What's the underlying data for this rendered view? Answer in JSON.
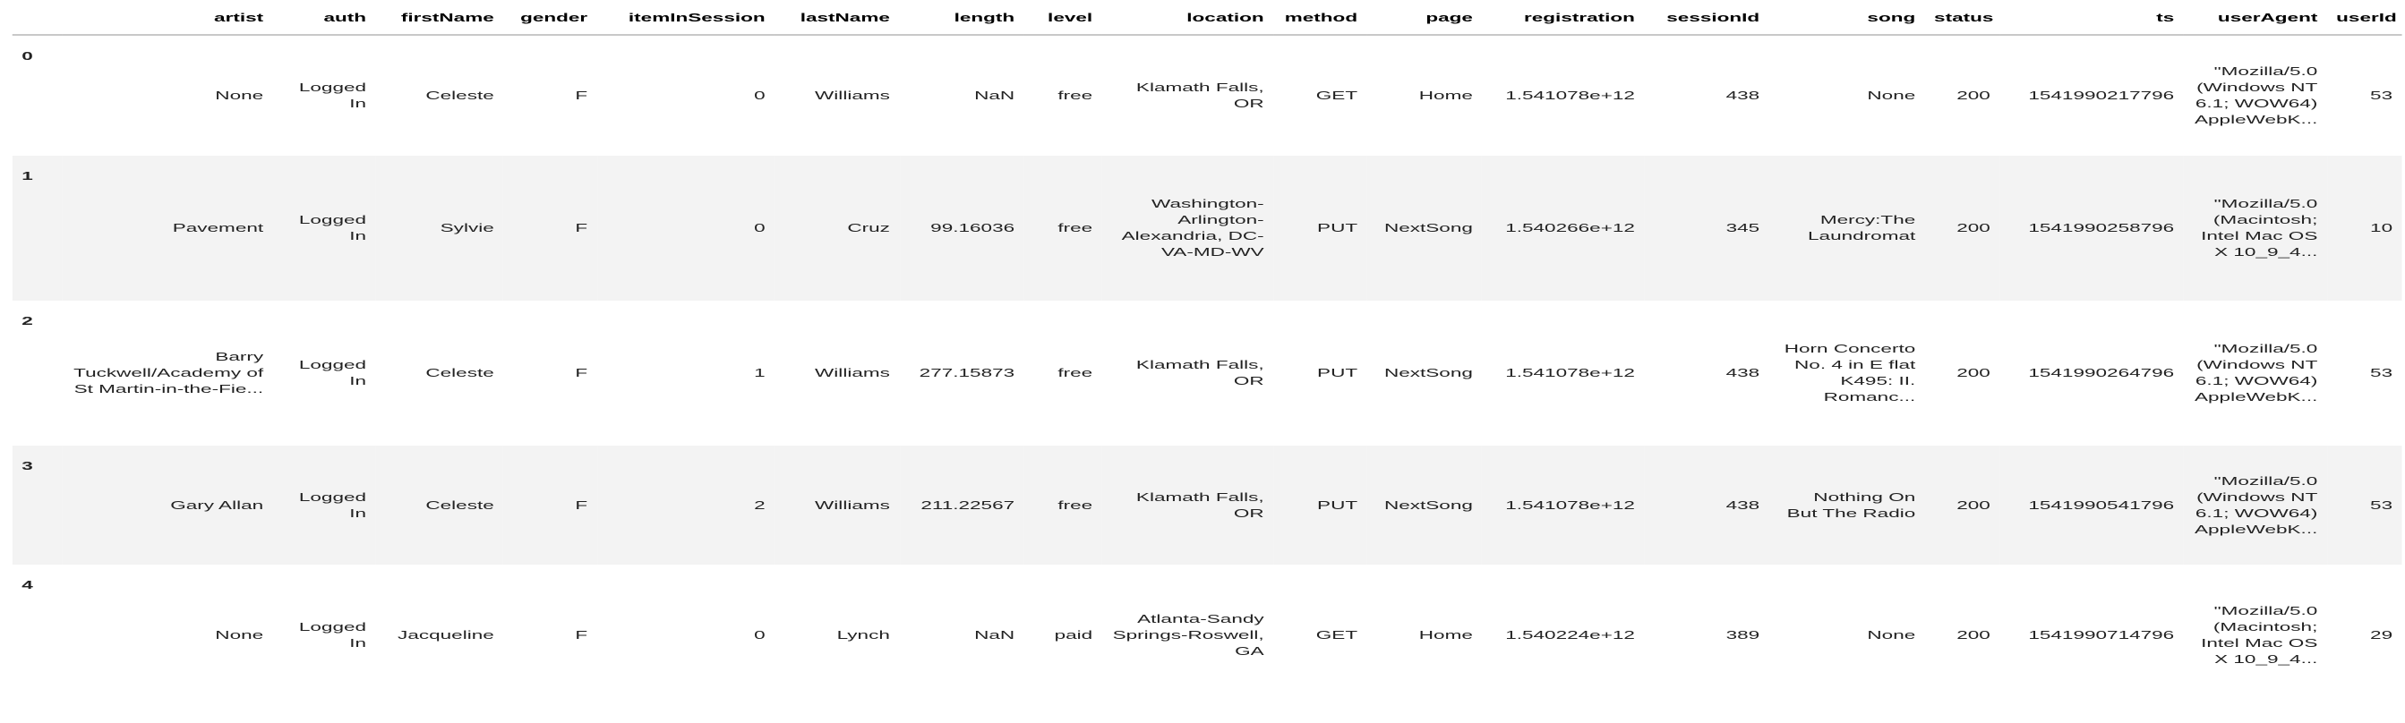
{
  "table": {
    "columns": [
      "",
      "artist",
      "auth",
      "firstName",
      "gender",
      "itemInSession",
      "lastName",
      "length",
      "level",
      "location",
      "method",
      "page",
      "registration",
      "sessionId",
      "song",
      "status",
      "ts",
      "userAgent",
      "userId"
    ],
    "rows": [
      {
        "index": "0",
        "artist": "None",
        "auth": "Logged In",
        "firstName": "Celeste",
        "gender": "F",
        "itemInSession": "0",
        "lastName": "Williams",
        "length": "NaN",
        "level": "free",
        "location": "Klamath Falls, OR",
        "method": "GET",
        "page": "Home",
        "registration": "1.541078e+12",
        "sessionId": "438",
        "song": "None",
        "status": "200",
        "ts": "1541990217796",
        "userAgent": "\"Mozilla/5.0 (Windows NT 6.1; WOW64) AppleWebK...",
        "userId": "53"
      },
      {
        "index": "1",
        "artist": "Pavement",
        "auth": "Logged In",
        "firstName": "Sylvie",
        "gender": "F",
        "itemInSession": "0",
        "lastName": "Cruz",
        "length": "99.16036",
        "level": "free",
        "location": "Washington-Arlington-Alexandria, DC-VA-MD-WV",
        "method": "PUT",
        "page": "NextSong",
        "registration": "1.540266e+12",
        "sessionId": "345",
        "song": "Mercy:The Laundromat",
        "status": "200",
        "ts": "1541990258796",
        "userAgent": "\"Mozilla/5.0 (Macintosh; Intel Mac OS X 10_9_4...",
        "userId": "10"
      },
      {
        "index": "2",
        "artist": "Barry Tuckwell/Academy of St Martin-in-the-Fie...",
        "auth": "Logged In",
        "firstName": "Celeste",
        "gender": "F",
        "itemInSession": "1",
        "lastName": "Williams",
        "length": "277.15873",
        "level": "free",
        "location": "Klamath Falls, OR",
        "method": "PUT",
        "page": "NextSong",
        "registration": "1.541078e+12",
        "sessionId": "438",
        "song": "Horn Concerto No. 4 in E flat K495: II. Romanc...",
        "status": "200",
        "ts": "1541990264796",
        "userAgent": "\"Mozilla/5.0 (Windows NT 6.1; WOW64) AppleWebK...",
        "userId": "53"
      },
      {
        "index": "3",
        "artist": "Gary Allan",
        "auth": "Logged In",
        "firstName": "Celeste",
        "gender": "F",
        "itemInSession": "2",
        "lastName": "Williams",
        "length": "211.22567",
        "level": "free",
        "location": "Klamath Falls, OR",
        "method": "PUT",
        "page": "NextSong",
        "registration": "1.541078e+12",
        "sessionId": "438",
        "song": "Nothing On But The Radio",
        "status": "200",
        "ts": "1541990541796",
        "userAgent": "\"Mozilla/5.0 (Windows NT 6.1; WOW64) AppleWebK...",
        "userId": "53"
      },
      {
        "index": "4",
        "artist": "None",
        "auth": "Logged In",
        "firstName": "Jacqueline",
        "gender": "F",
        "itemInSession": "0",
        "lastName": "Lynch",
        "length": "NaN",
        "level": "paid",
        "location": "Atlanta-Sandy Springs-Roswell, GA",
        "method": "GET",
        "page": "Home",
        "registration": "1.540224e+12",
        "sessionId": "389",
        "song": "None",
        "status": "200",
        "ts": "1541990714796",
        "userAgent": "\"Mozilla/5.0 (Macintosh; Intel Mac OS X 10_9_4...",
        "userId": "29"
      }
    ]
  }
}
